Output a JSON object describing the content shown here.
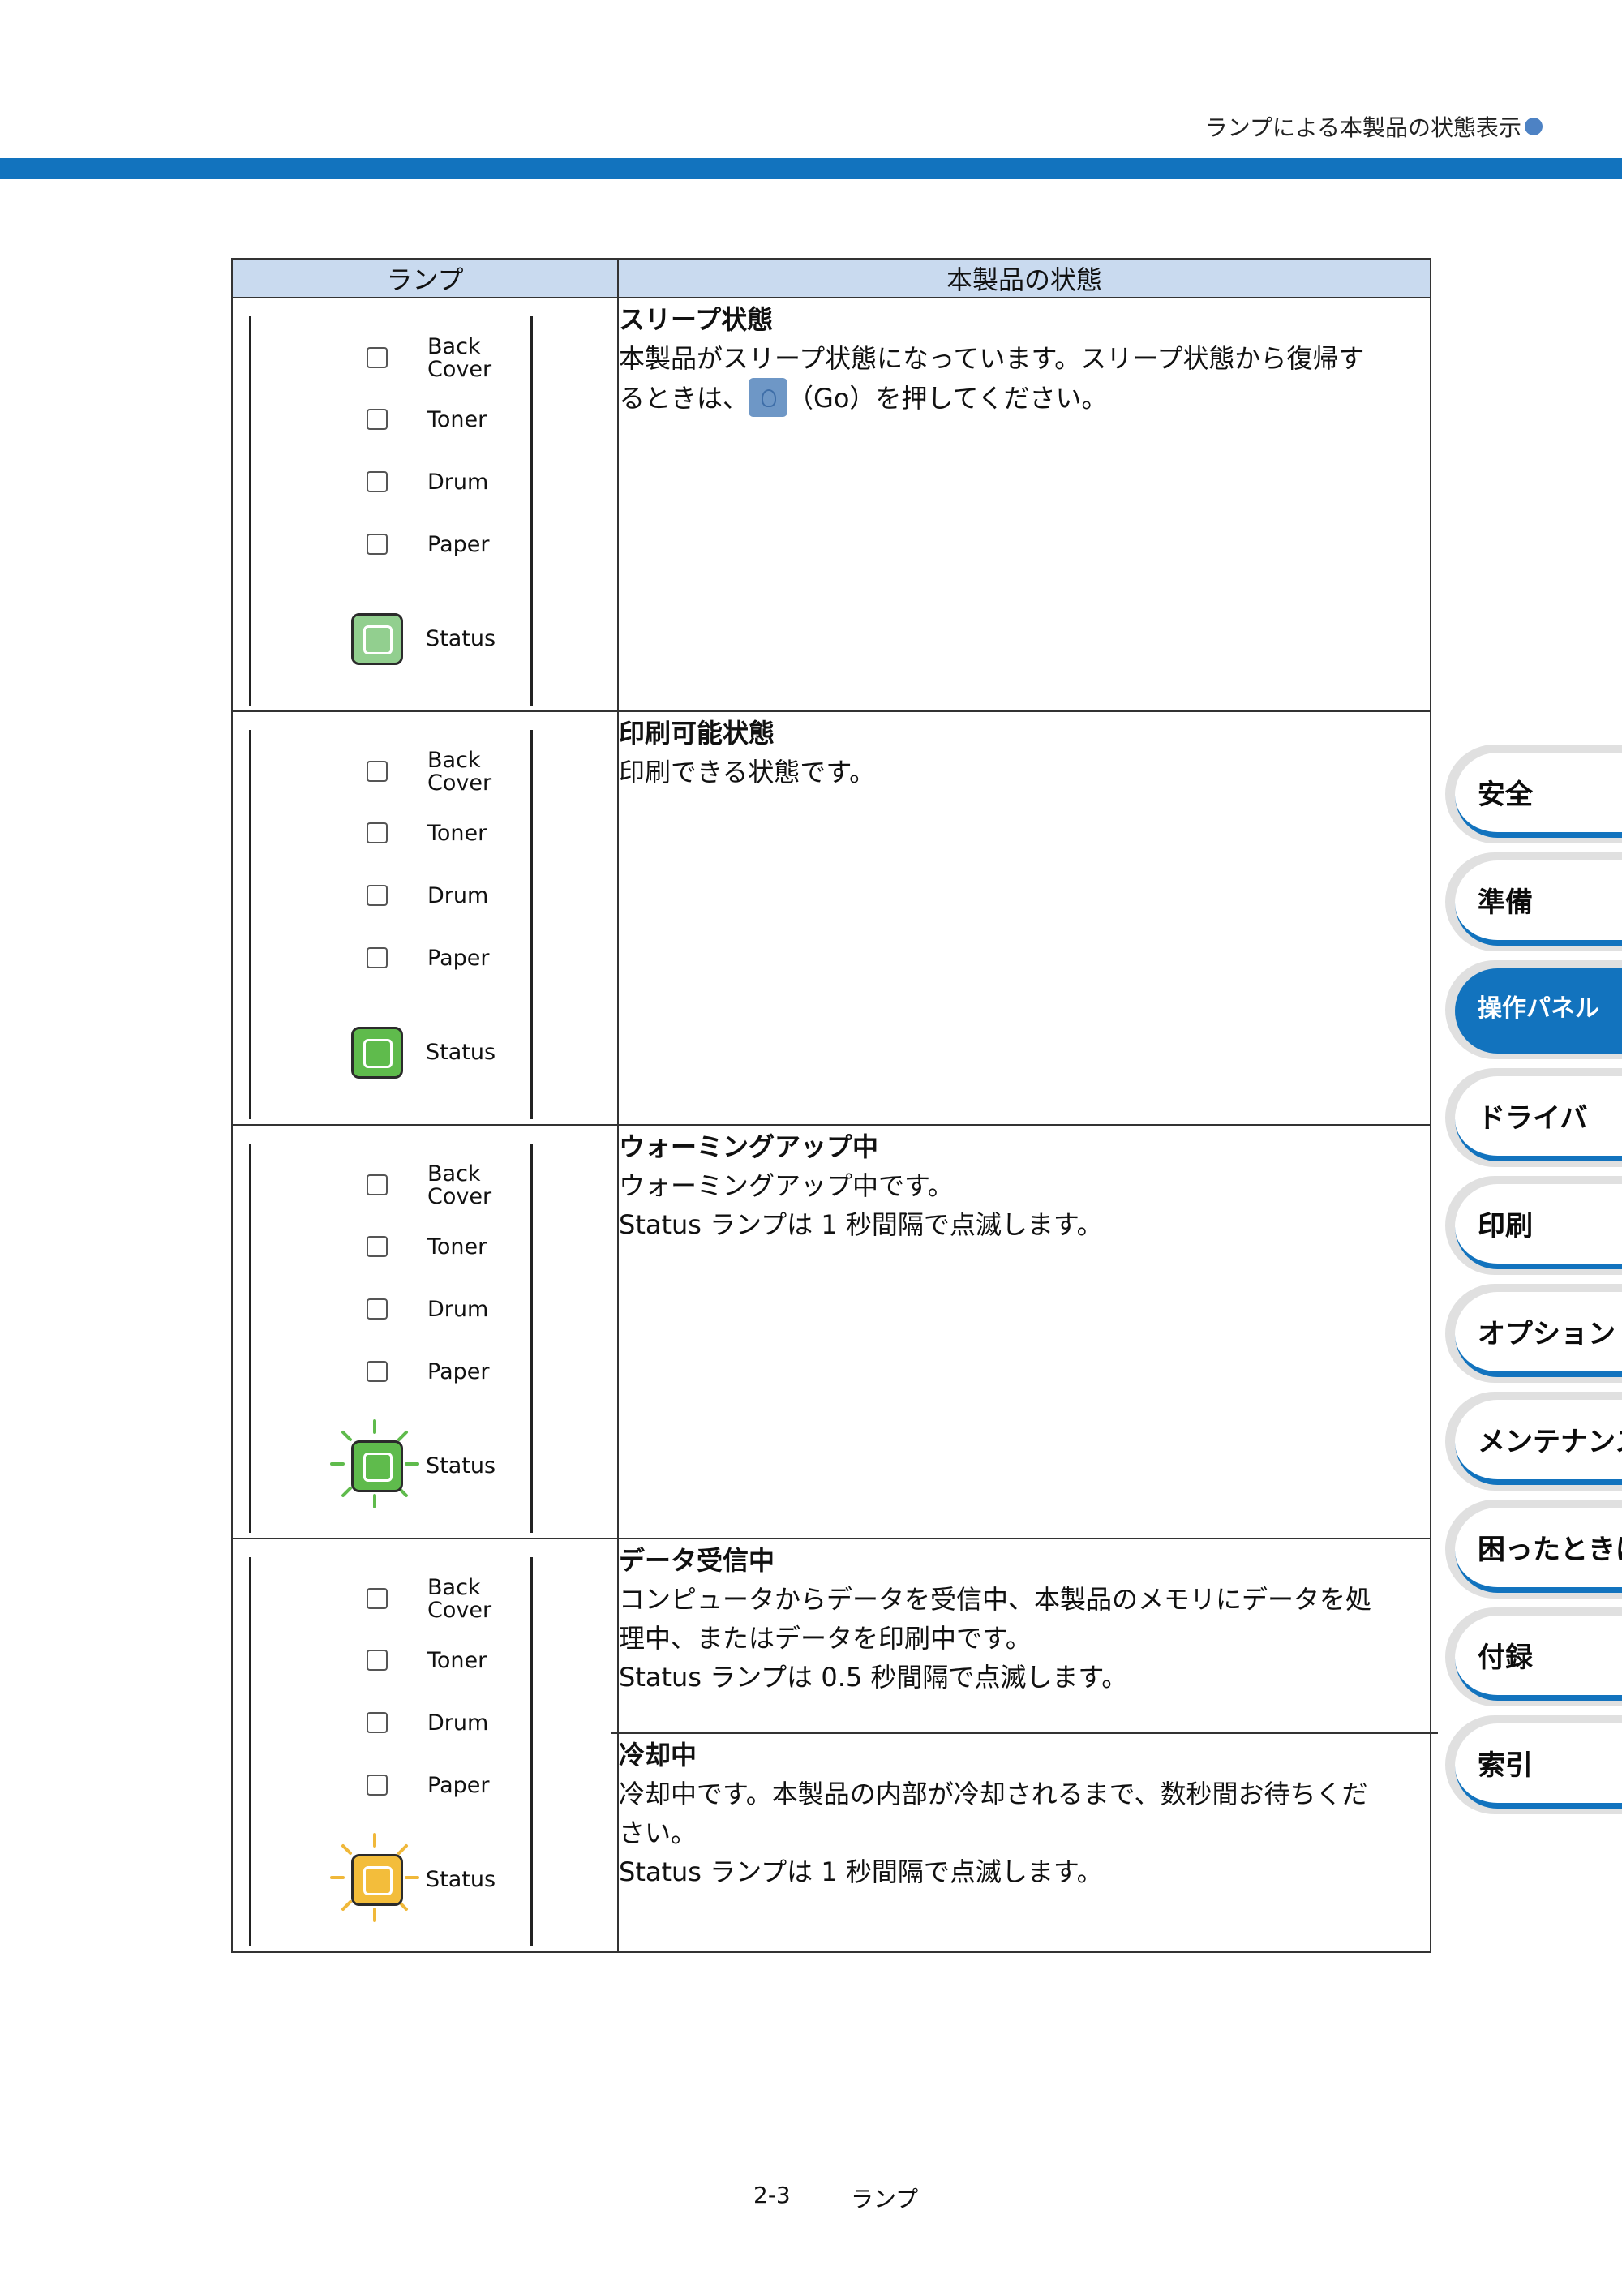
{
  "header": {
    "title": "ランプによる本製品の状態表示"
  },
  "table": {
    "col_lamp": "ランプ",
    "col_state": "本製品の状態",
    "lamp_labels": {
      "back_cover_1": "Back",
      "back_cover_2": "Cover",
      "toner": "Toner",
      "drum": "Drum",
      "paper": "Paper",
      "status": "Status"
    },
    "rows": [
      {
        "title": "スリープ状態",
        "body1_a": "本製品がスリープ状態になっています。スリープ状態から復帰す",
        "body1_b": "るときは、",
        "body1_c": "（Go）を押してください。",
        "status_color": "#92cf8f",
        "status_blink": false
      },
      {
        "title": "印刷可能状態",
        "body1": "印刷できる状態です。",
        "status_color": "#5fbb4c",
        "status_blink": false
      },
      {
        "title": "ウォーミングアップ中",
        "body1": "ウォーミングアップ中です。",
        "body2": "Status ランプは 1 秒間隔で点滅します。",
        "status_color": "#5fbb4c",
        "status_blink": true,
        "ray_color": "#5fbb4c"
      },
      {
        "title": "データ受信中",
        "body1": "コンピュータからデータを受信中、本製品のメモリにデータを処",
        "body2": "理中、またはデータを印刷中です。",
        "body3": "Status ランプは 0.5 秒間隔で点滅します。",
        "title2": "冷却中",
        "body4": "冷却中です。本製品の内部が冷却されるまで、数秒間お待ちくだ",
        "body5": "さい。",
        "body6": "Status ランプは 1 秒間隔で点滅します。",
        "status_color": "#f3bd3b",
        "status_blink": true,
        "ray_color": "#f0b83a"
      }
    ]
  },
  "tabs": [
    "安全",
    "準備",
    "操作パネル",
    "ドライバ",
    "印刷",
    "オプション",
    "メンテナンス",
    "困ったときは",
    "付録",
    "索引"
  ],
  "active_tab": "操作パネル",
  "footer": {
    "page": "2-3",
    "title": "ランプ"
  },
  "colors": {
    "accent": "#1273be",
    "header_cell": "#c9daef"
  }
}
